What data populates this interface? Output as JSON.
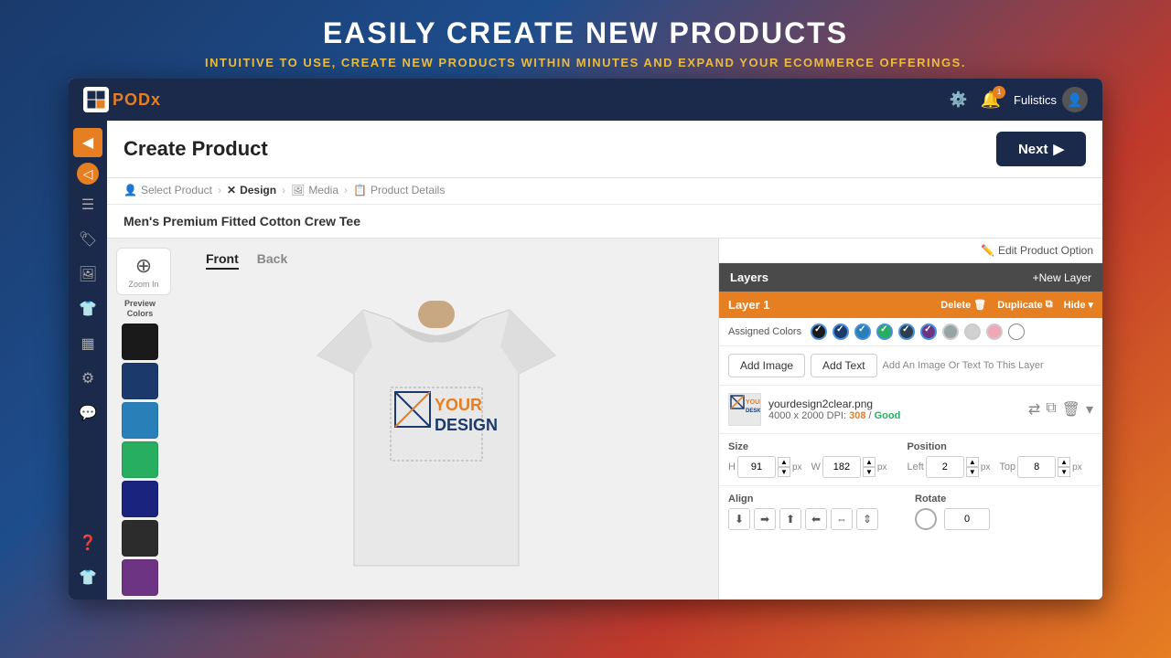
{
  "hero": {
    "title": "EASILY CREATE NEW PRODUCTS",
    "subtitle": "INTUITIVE TO USE, CREATE NEW PRODUCTS WITHIN MINUTES AND EXPAND YOUR ECOMMERCE OFFERINGS."
  },
  "navbar": {
    "logo_text": "POD",
    "logo_accent": "x",
    "user_name": "Fulistics",
    "notification_count": "1"
  },
  "page": {
    "title": "Create Product",
    "next_button": "Next"
  },
  "breadcrumb": {
    "items": [
      {
        "label": "Select Product",
        "icon": "person-icon"
      },
      {
        "label": "Design",
        "icon": "design-icon",
        "active": true
      },
      {
        "label": "Media",
        "icon": "media-icon"
      },
      {
        "label": "Product Details",
        "icon": "details-icon"
      }
    ]
  },
  "product": {
    "name": "Men's Premium Fitted Cotton Crew Tee"
  },
  "canvas": {
    "zoom_label": "Zoom In",
    "tabs": [
      {
        "label": "Front",
        "active": true
      },
      {
        "label": "Back",
        "active": false
      }
    ]
  },
  "preview_colors": {
    "label": "Preview Colors",
    "swatches": [
      "#1a1a1a",
      "#1b3a6b",
      "#2980b9",
      "#27ae60",
      "#1a237e",
      "#222222",
      "#6c3483"
    ]
  },
  "layers": {
    "title": "Layers",
    "new_layer_btn": "+New Layer",
    "layer1": {
      "name": "Layer 1",
      "delete_label": "Delete",
      "duplicate_label": "Duplicate",
      "hide_label": "Hide"
    },
    "assigned_colors_label": "Assigned Colors",
    "add_image_btn": "Add Image",
    "add_text_btn": "Add Text",
    "add_hint": "Add An Image Or Text To This Layer",
    "image": {
      "name": "yourdesign2clear.png",
      "dimensions": "4000 x 2000",
      "dpi_label": "DPI:",
      "dpi_value": "308",
      "quality": "Good"
    },
    "size": {
      "label": "Size",
      "h_label": "H",
      "h_value": "91",
      "w_label": "W",
      "w_value": "182",
      "unit": "px"
    },
    "position": {
      "label": "Position",
      "left_label": "Left",
      "left_value": "2",
      "top_label": "Top",
      "top_value": "8",
      "unit": "px"
    },
    "align": {
      "label": "Align",
      "icons": [
        "⬇",
        "➡",
        "⬆",
        "⬅",
        "⇔",
        "⇕"
      ]
    },
    "rotate": {
      "label": "Rotate",
      "value": "0"
    }
  },
  "edit_product_option": "Edit Product Option",
  "sidebar_icons": [
    "👤",
    "☰",
    "🏷",
    "🖼",
    "👕",
    "🔲",
    "⚙",
    "💬",
    "❓"
  ]
}
